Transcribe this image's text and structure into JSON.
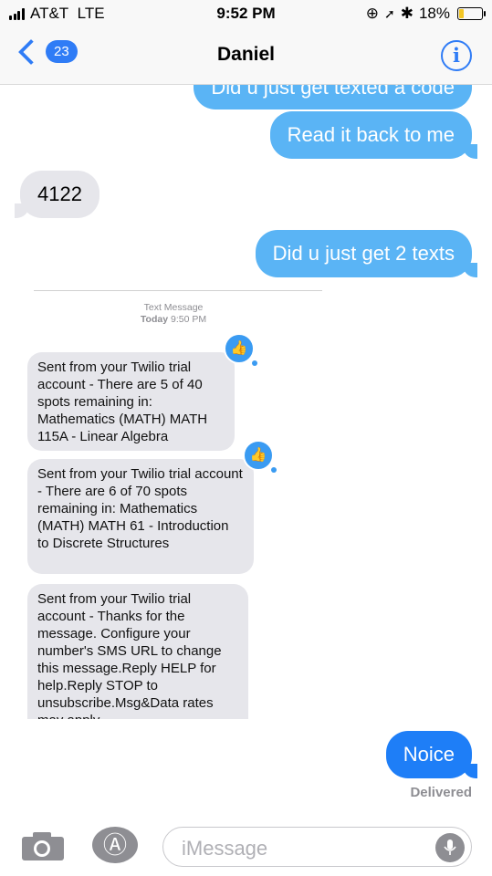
{
  "status": {
    "carrier": "AT&T",
    "network": "LTE",
    "time": "9:52 PM",
    "battery": "18%"
  },
  "nav": {
    "back_count": "23",
    "title": "Daniel",
    "info_glyph": "i"
  },
  "messages": [
    {
      "text": "Did u just get texted a code"
    },
    {
      "text": "Read it back to me"
    },
    {
      "text": "4122"
    },
    {
      "text": "Did u just get 2 texts"
    }
  ],
  "timestamp": {
    "label": "Text Message",
    "day": "Today",
    "time": "9:50 PM"
  },
  "sms": [
    {
      "text": "Sent from your Twilio trial account - There are 5 of 40 spots remaining in: Mathematics (MATH) MATH 115A - Linear Algebra"
    },
    {
      "text": "Sent from your Twilio trial account - There are 6 of 70 spots remaining in: Mathematics (MATH) MATH 61 - Introduction to Discrete Structures"
    },
    {
      "text": "Sent from your Twilio trial account - Thanks for the message. Configure your number's SMS URL to change this message.Reply HELP for help.Reply STOP to unsubscribe.Msg&Data rates may apply."
    }
  ],
  "last_message": {
    "text": "Noice",
    "status": "Delivered"
  },
  "input": {
    "placeholder": "iMessage"
  },
  "icons": {
    "camera": "camera-icon",
    "appstore": "app-store-icon",
    "mic": "microphone-icon",
    "tapback": "thumbs-up-icon"
  },
  "colors": {
    "accent": "#2f7cf6",
    "sent_bubble": "#5ab4f5",
    "received_bubble": "#e6e6eb"
  }
}
